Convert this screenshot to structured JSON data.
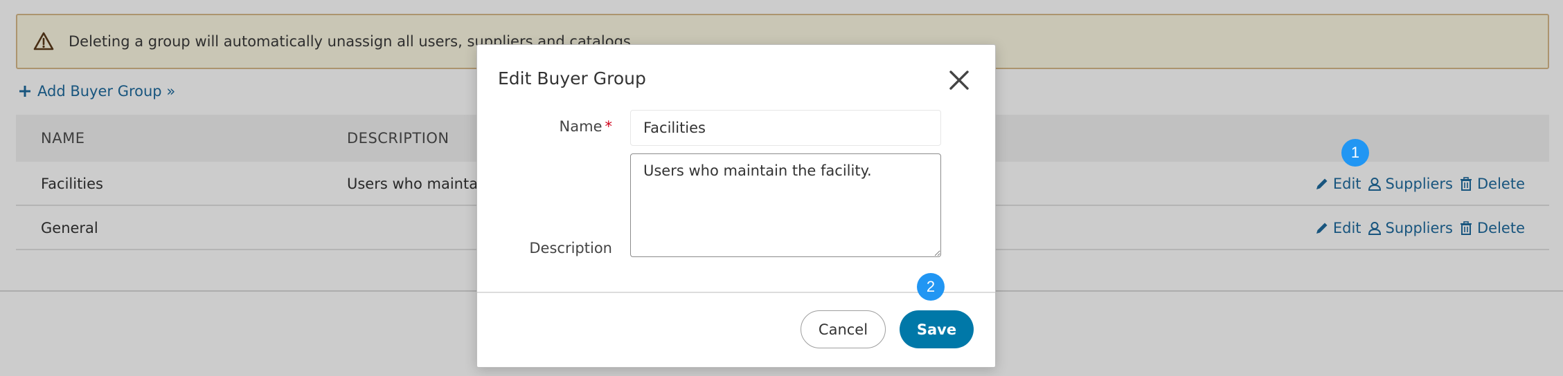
{
  "alert": {
    "icon": "warning-triangle-icon",
    "text": "Deleting a group will automatically unassign all users, suppliers and catalogs."
  },
  "toolbar": {
    "add_label": "Add Buyer Group »"
  },
  "table": {
    "headers": {
      "name": "NAME",
      "description": "DESCRIPTION"
    },
    "rows": [
      {
        "name": "Facilities",
        "description": "Users who maintain the facility."
      },
      {
        "name": "General",
        "description": ""
      }
    ],
    "actions": {
      "edit": "Edit",
      "suppliers": "Suppliers",
      "delete": "Delete"
    }
  },
  "badges": {
    "one": "1",
    "two": "2"
  },
  "modal": {
    "title": "Edit Buyer Group",
    "name_label": "Name",
    "required_mark": "*",
    "name_value": "Facilities",
    "description_label": "Description",
    "description_value": "Users who maintain the facility.",
    "cancel_label": "Cancel",
    "save_label": "Save"
  },
  "colors": {
    "link": "#1f6b9e",
    "primary_button": "#0078a8",
    "badge": "#2196f3",
    "alert_bg": "#fcf8e3",
    "alert_border": "#d7b98a",
    "required": "#d0021b"
  }
}
